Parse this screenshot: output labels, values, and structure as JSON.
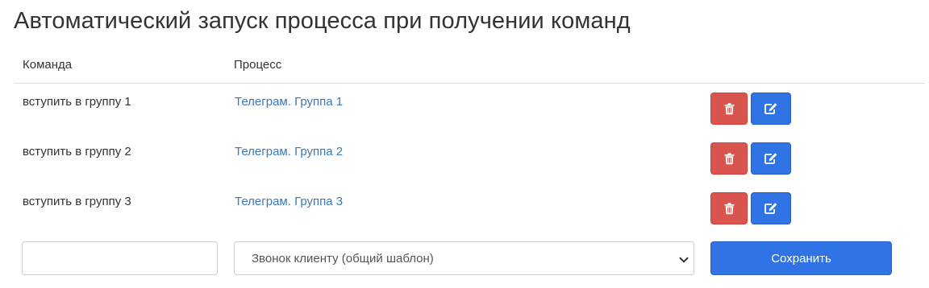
{
  "page": {
    "title": "Автоматический запуск процесса при получении команд"
  },
  "table": {
    "headers": {
      "command": "Команда",
      "process": "Процесс"
    },
    "rows": [
      {
        "command": "вступить в группу 1",
        "process": "Телеграм. Группа 1"
      },
      {
        "command": "вступить в группу 2",
        "process": "Телеграм. Группа 2"
      },
      {
        "command": "вступить в группу 3",
        "process": "Телеграм. Группа 3"
      }
    ],
    "row_actions": {
      "delete_icon": "trash-icon",
      "edit_icon": "edit-icon"
    }
  },
  "form": {
    "command_input": {
      "value": "",
      "placeholder": ""
    },
    "process_select": {
      "selected": "Звонок клиенту (общий шаблон)"
    },
    "save_label": "Сохранить"
  },
  "colors": {
    "primary": "#2f73e5",
    "danger": "#d9534f",
    "link": "#3a78b8",
    "text": "#333333"
  }
}
